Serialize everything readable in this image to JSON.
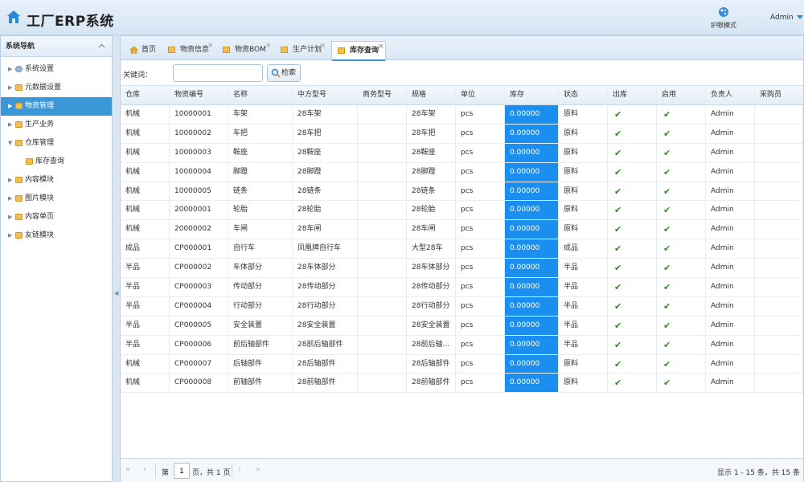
{
  "header": {
    "title": "工厂ERP系统",
    "mode_label": "护眼模式",
    "user": "Admin"
  },
  "sidebar": {
    "title": "系统导航",
    "items": [
      {
        "label": "系统设置",
        "icon": "gear-icon"
      },
      {
        "label": "元数据设置",
        "icon": "folder-icon"
      },
      {
        "label": "物资管理",
        "icon": "folder-icon",
        "active": true
      },
      {
        "label": "生产业务",
        "icon": "folder-icon"
      },
      {
        "label": "仓库管理",
        "icon": "folder-icon",
        "expanded": true
      },
      {
        "label": "库存查询",
        "icon": "folder-icon",
        "child": true
      },
      {
        "label": "内容模块",
        "icon": "folder-icon"
      },
      {
        "label": "图片模块",
        "icon": "folder-icon"
      },
      {
        "label": "内容单页",
        "icon": "folder-icon"
      },
      {
        "label": "友链模块",
        "icon": "folder-icon"
      }
    ]
  },
  "tabs": [
    {
      "label": "首页",
      "closable": false
    },
    {
      "label": "物资信息",
      "closable": true
    },
    {
      "label": "物资BOM",
      "closable": true
    },
    {
      "label": "生产计划",
      "closable": true
    },
    {
      "label": "库存查询",
      "closable": true,
      "active": true
    }
  ],
  "toolbar": {
    "keyword_label": "关键词：",
    "keyword_value": "",
    "search_label": "检索"
  },
  "table": {
    "columns": [
      "仓库",
      "物资编号",
      "名称",
      "中方型号",
      "商务型号",
      "规格",
      "单位",
      "库存",
      "状态",
      "出库",
      "启用",
      "负责人",
      "采购员"
    ],
    "rows": [
      [
        "机械",
        "10000001",
        "车架",
        "28车架",
        "",
        "28车架",
        "pcs",
        "0.00000",
        "原料",
        "✔",
        "✔",
        "Admin",
        ""
      ],
      [
        "机械",
        "10000002",
        "车把",
        "28车把",
        "",
        "28车把",
        "pcs",
        "0.00000",
        "原料",
        "✔",
        "✔",
        "Admin",
        ""
      ],
      [
        "机械",
        "10000003",
        "鞍座",
        "28鞍座",
        "",
        "28鞍座",
        "pcs",
        "0.00000",
        "原料",
        "✔",
        "✔",
        "Admin",
        ""
      ],
      [
        "机械",
        "10000004",
        "脚蹬",
        "28脚蹬",
        "",
        "28脚蹬",
        "pcs",
        "0.00000",
        "原料",
        "✔",
        "✔",
        "Admin",
        ""
      ],
      [
        "机械",
        "10000005",
        "链条",
        "28链条",
        "",
        "28链条",
        "pcs",
        "0.00000",
        "原料",
        "✔",
        "✔",
        "Admin",
        ""
      ],
      [
        "机械",
        "20000001",
        "轮胎",
        "28轮胎",
        "",
        "28轮胎",
        "pcs",
        "0.00000",
        "原料",
        "✔",
        "✔",
        "Admin",
        ""
      ],
      [
        "机械",
        "20000002",
        "车闸",
        "28车闸",
        "",
        "28车闸",
        "pcs",
        "0.00000",
        "原料",
        "✔",
        "✔",
        "Admin",
        ""
      ],
      [
        "成品",
        "CP000001",
        "自行车",
        "凤凰牌自行车",
        "",
        "大型28车",
        "pcs",
        "0.00000",
        "成品",
        "✔",
        "✔",
        "Admin",
        ""
      ],
      [
        "半品",
        "CP000002",
        "车体部分",
        "28车体部分",
        "",
        "28车体部分",
        "pcs",
        "0.00000",
        "半品",
        "✔",
        "✔",
        "Admin",
        ""
      ],
      [
        "半品",
        "CP000003",
        "传动部分",
        "28传动部分",
        "",
        "28传动部分",
        "pcs",
        "0.00000",
        "半品",
        "✔",
        "✔",
        "Admin",
        ""
      ],
      [
        "半品",
        "CP000004",
        "行动部分",
        "28行动部分",
        "",
        "28行动部分",
        "pcs",
        "0.00000",
        "半品",
        "✔",
        "✔",
        "Admin",
        ""
      ],
      [
        "半品",
        "CP000005",
        "安全装置",
        "28安全装置",
        "",
        "28安全装置",
        "pcs",
        "0.00000",
        "半品",
        "✔",
        "✔",
        "Admin",
        ""
      ],
      [
        "半品",
        "CP000006",
        "前后轴部件",
        "28前后轴部件",
        "",
        "28前后轴...",
        "pcs",
        "0.00000",
        "半品",
        "✔",
        "✔",
        "Admin",
        ""
      ],
      [
        "机械",
        "CP000007",
        "后轴部件",
        "28后轴部件",
        "",
        "28后轴部件",
        "pcs",
        "0.00000",
        "原料",
        "✔",
        "✔",
        "Admin",
        ""
      ],
      [
        "机械",
        "CP000008",
        "前轴部件",
        "28前轴部件",
        "",
        "28前轴部件",
        "pcs",
        "0.00000",
        "原料",
        "✔",
        "✔",
        "Admin",
        ""
      ]
    ]
  },
  "pager": {
    "page_prefix": "第",
    "page_value": "1",
    "page_suffix": "页，共 1 页",
    "info": "显示 1 - 15 条，共 15 条"
  },
  "colors": {
    "accent": "#3a97d8",
    "stock_cell": "#1a8ff0",
    "check": "#2e8b1f"
  }
}
